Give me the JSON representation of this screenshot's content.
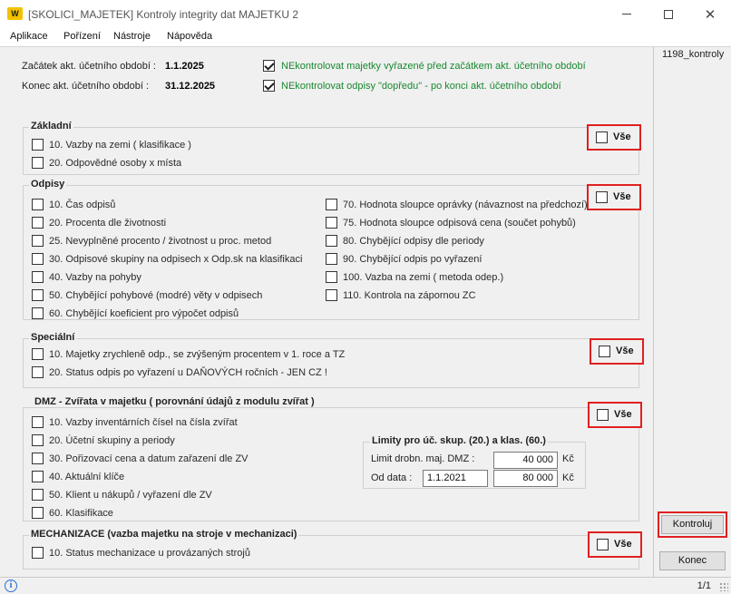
{
  "window": {
    "logo_text": "W",
    "title": "[SKOLICI_MAJETEK] Kontroly integrity dat MAJETKU 2"
  },
  "menu": [
    "Aplikace",
    "Pořízení",
    "Nástroje",
    "Nápověda"
  ],
  "period": {
    "start_label": "Začátek akt. účetního období :",
    "start_value": "1.1.2025",
    "end_label": "Konec akt. účetního období :",
    "end_value": "31.12.2025"
  },
  "options": {
    "opt1": {
      "label": "NEkontrolovat majetky vyřazené před začátkem akt. účetního období",
      "checked": true
    },
    "opt2": {
      "label": "NEkontrolovat odpisy \"dopředu\" - po konci akt. účetního období",
      "checked": true
    }
  },
  "select_all_label": "Vše",
  "groups": {
    "zakladni": {
      "title": "Základní",
      "items": [
        "10. Vazby na zemi ( klasifikace )",
        "20. Odpovědné osoby x místa"
      ]
    },
    "odpisy": {
      "title": "Odpisy",
      "left": [
        "10. Čas odpisů",
        "20. Procenta dle životnosti",
        "25. Nevyplněné procento / životnost u proc. metod",
        "30. Odpisové skupiny na odpisech x Odp.sk na klasifikaci",
        "40. Vazby na pohyby",
        "50. Chybějící pohybové (modré) věty v odpisech",
        "60. Chybějící koeficient pro výpočet odpisů"
      ],
      "right": [
        "70. Hodnota sloupce oprávky (návaznost na předchozí)",
        "75. Hodnota sloupce odpisová cena (součet pohybů)",
        "80. Chybějící odpisy dle periody",
        "90. Chybějící odpis po vyřazení",
        "100. Vazba na zemi ( metoda odep.)",
        "110. Kontrola na zápornou ZC"
      ]
    },
    "specialni": {
      "title": "Speciální",
      "items": [
        "10. Majetky zrychleně odp., se zvýšeným procentem v 1. roce a TZ",
        "20. Status odpis po vyřazení u DAŇOVÝCH ročních - JEN CZ !"
      ]
    },
    "dmz": {
      "title": "DMZ - Zvířata v majetku ( porovnání údajů z modulu zvířat )",
      "items": [
        "10. Vazby inventárních čísel na čísla zvířat",
        "20. Účetní skupiny a periody",
        "30. Pořizovací cena a datum zařazení dle ZV",
        "40. Aktuální klíče",
        "50. Klient u nákupů / vyřazení dle ZV",
        "60. Klasifikace"
      ],
      "limits": {
        "title": "Limity pro úč. skup. (20.) a klas. (60.)",
        "limit_label": "Limit drobn. maj. DMZ :",
        "limit_value": "40 000",
        "date_label": "Od data :",
        "date_value": "1.1.2021",
        "date_amount": "80 000",
        "currency": "Kč"
      }
    },
    "mechanizace": {
      "title": "MECHANIZACE (vazba majetku na stroje v mechanizaci)",
      "items": [
        "10. Status mechanizace u provázaných strojů"
      ]
    }
  },
  "right_panel": {
    "code": "1198_kontroly",
    "check_button": "Kontroluj",
    "close_button": "Konec"
  },
  "status": {
    "info_icon": "i",
    "pager": "1/1"
  }
}
